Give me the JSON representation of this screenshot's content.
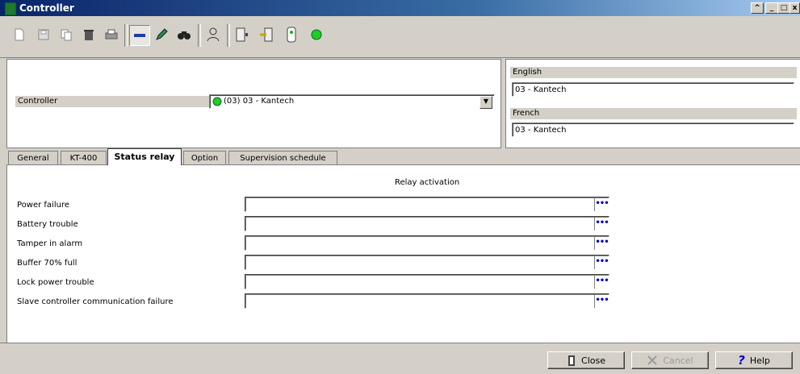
{
  "window": {
    "title": "Controller",
    "controls": [
      "^",
      "_",
      "□",
      "x"
    ]
  },
  "toolbar": {
    "icons": [
      "new-icon",
      "save-icon",
      "copy-icon",
      "delete-icon",
      "print-icon",
      "link-icon",
      "pencil-icon",
      "find-icon",
      "user-icon",
      "door-icon",
      "relay-icon",
      "input-icon",
      "status-light-icon"
    ]
  },
  "header": {
    "controller_label": "Controller",
    "controller_value": "(03) 03 - Kantech",
    "english_label": "English",
    "english_value": "03 - Kantech",
    "french_label": "French",
    "french_value": "03 - Kantech"
  },
  "tabs": [
    {
      "label": "General"
    },
    {
      "label": "KT-400"
    },
    {
      "label": "Status relay",
      "active": true
    },
    {
      "label": "Option"
    },
    {
      "label": "Supervision schedule"
    }
  ],
  "content": {
    "column_header": "Relay activation",
    "rows": [
      {
        "label": "Power failure",
        "value": ""
      },
      {
        "label": "Battery trouble",
        "value": ""
      },
      {
        "label": "Tamper in alarm",
        "value": ""
      },
      {
        "label": "Buffer 70% full",
        "value": ""
      },
      {
        "label": "Lock power trouble",
        "value": ""
      },
      {
        "label": "Slave controller communication failure",
        "value": ""
      }
    ],
    "browse_glyph": "•••"
  },
  "buttons": {
    "close": "Close",
    "cancel": "Cancel",
    "help": "Help"
  },
  "colors": {
    "titlebar": "#0a246a",
    "status_green": "#22cc22",
    "browse_blue": "#0000cc"
  }
}
